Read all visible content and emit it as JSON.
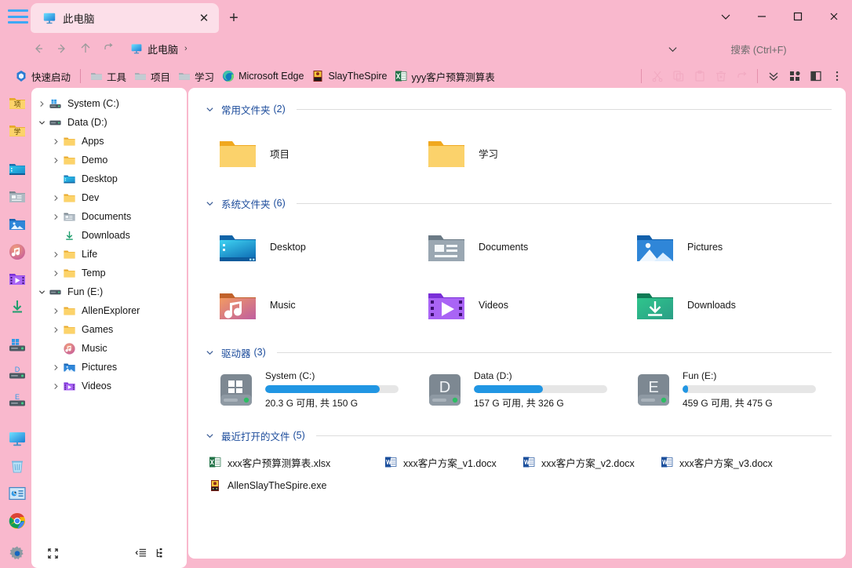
{
  "window": {
    "tab": {
      "title": "此电脑",
      "icon": "this-pc-icon",
      "close": "✕"
    },
    "new_tab": "+",
    "controls": {
      "chevron": "chevron-down-icon",
      "minimize": "minimize-icon",
      "maximize": "maximize-icon",
      "close": "close-icon"
    }
  },
  "addressbar": {
    "back": "back-arrow-icon",
    "forward": "forward-arrow-icon",
    "up": "up-arrow-icon",
    "refresh": "undo-icon",
    "breadcrumb": {
      "label": "此电脑",
      "arrow": "›"
    },
    "search_placeholder": "搜索 (Ctrl+F)",
    "search_chevron": "chevron-down-icon"
  },
  "quicklaunch": {
    "title": "快速启动",
    "items": [
      {
        "label": "工具",
        "icon": "folder-icon"
      },
      {
        "label": "项目",
        "icon": "folder-icon"
      },
      {
        "label": "学习",
        "icon": "folder-icon"
      },
      {
        "label": "Microsoft Edge",
        "icon": "edge-icon"
      },
      {
        "label": "SlayTheSpire",
        "icon": "game-exe-icon"
      },
      {
        "label": "yyy客户预算测算表",
        "icon": "excel-icon"
      }
    ],
    "toolbar": [
      {
        "name": "cut-icon"
      },
      {
        "name": "copy-icon"
      },
      {
        "name": "paste-icon"
      },
      {
        "name": "delete-icon"
      },
      {
        "name": "undo-icon"
      },
      {
        "name": "chevron-double-down-icon"
      },
      {
        "name": "layout-grid-icon"
      },
      {
        "name": "split-pane-icon"
      },
      {
        "name": "more-options-icon"
      }
    ]
  },
  "rail": {
    "items": [
      {
        "name": "rail-folder-xiang",
        "label": "项"
      },
      {
        "name": "rail-folder-xue",
        "label": "学"
      },
      {
        "name": "rail-desktop"
      },
      {
        "name": "rail-documents"
      },
      {
        "name": "rail-pictures"
      },
      {
        "name": "rail-music"
      },
      {
        "name": "rail-videos"
      },
      {
        "name": "rail-downloads"
      },
      {
        "name": "rail-drive-c"
      },
      {
        "name": "rail-drive-d"
      },
      {
        "name": "rail-drive-e"
      },
      {
        "name": "rail-this-pc"
      },
      {
        "name": "rail-recycle-bin"
      },
      {
        "name": "rail-control-panel"
      },
      {
        "name": "rail-chrome"
      },
      {
        "name": "rail-settings"
      }
    ]
  },
  "tree": {
    "nodes": [
      {
        "label": "System (C:)",
        "icon": "drive-windows-icon",
        "indent": 0,
        "chevron": "collapsed"
      },
      {
        "label": "Data (D:)",
        "icon": "drive-icon",
        "indent": 0,
        "chevron": "expanded"
      },
      {
        "label": "Apps",
        "icon": "folder-icon",
        "indent": 1,
        "chevron": "collapsed"
      },
      {
        "label": "Demo",
        "icon": "folder-icon",
        "indent": 1,
        "chevron": "collapsed"
      },
      {
        "label": "Desktop",
        "icon": "desktop-folder-icon",
        "indent": 1,
        "chevron": "none"
      },
      {
        "label": "Dev",
        "icon": "folder-icon",
        "indent": 1,
        "chevron": "collapsed"
      },
      {
        "label": "Documents",
        "icon": "documents-folder-icon",
        "indent": 1,
        "chevron": "collapsed"
      },
      {
        "label": "Downloads",
        "icon": "downloads-arrow-icon",
        "indent": 1,
        "chevron": "none"
      },
      {
        "label": "Life",
        "icon": "folder-icon",
        "indent": 1,
        "chevron": "collapsed"
      },
      {
        "label": "Temp",
        "icon": "folder-icon",
        "indent": 1,
        "chevron": "collapsed"
      },
      {
        "label": "Fun (E:)",
        "icon": "drive-icon",
        "indent": 0,
        "chevron": "expanded"
      },
      {
        "label": "AllenExplorer",
        "icon": "folder-icon",
        "indent": 1,
        "chevron": "collapsed"
      },
      {
        "label": "Games",
        "icon": "folder-icon",
        "indent": 1,
        "chevron": "collapsed"
      },
      {
        "label": "Music",
        "icon": "music-circle-icon",
        "indent": 1,
        "chevron": "none"
      },
      {
        "label": "Pictures",
        "icon": "pictures-folder-icon",
        "indent": 1,
        "chevron": "collapsed"
      },
      {
        "label": "Videos",
        "icon": "videos-folder-icon",
        "indent": 1,
        "chevron": "collapsed"
      }
    ]
  },
  "statusbar": {
    "buttons": [
      {
        "name": "collapse-all-icon"
      },
      {
        "name": "indent-list-icon"
      },
      {
        "name": "tree-view-icon"
      }
    ]
  },
  "main": {
    "groups": [
      {
        "id": "frequent",
        "title": "常用文件夹",
        "count": "(2)",
        "items": [
          {
            "label": "项目",
            "icon": "folder-icon"
          },
          {
            "label": "学习",
            "icon": "folder-icon"
          }
        ]
      },
      {
        "id": "system",
        "title": "系统文件夹",
        "count": "(6)",
        "items": [
          {
            "label": "Desktop",
            "icon": "desktop-folder-icon"
          },
          {
            "label": "Documents",
            "icon": "documents-folder-icon"
          },
          {
            "label": "Pictures",
            "icon": "pictures-folder-icon"
          },
          {
            "label": "Music",
            "icon": "music-folder-icon"
          },
          {
            "label": "Videos",
            "icon": "videos-folder-icon"
          },
          {
            "label": "Downloads",
            "icon": "downloads-folder-icon"
          }
        ]
      },
      {
        "id": "drives",
        "title": "驱动器",
        "count": "(3)",
        "drives": [
          {
            "name": "System (C:)",
            "letter": "",
            "icon": "drive-windows-icon",
            "free_text": "20.3 G 可用, 共 150 G",
            "used_percent": 86
          },
          {
            "name": "Data (D:)",
            "letter": "D",
            "icon": "drive-letter-icon",
            "free_text": "157 G 可用, 共 326 G",
            "used_percent": 52
          },
          {
            "name": "Fun (E:)",
            "letter": "E",
            "icon": "drive-letter-icon",
            "free_text": "459 G 可用, 共 475 G",
            "used_percent": 4
          }
        ]
      },
      {
        "id": "recent",
        "title": "最近打开的文件",
        "count": "(5)",
        "files": [
          {
            "label": "xxx客户预算测算表.xlsx",
            "icon": "excel-icon"
          },
          {
            "label": "xxx客户方案_v1.docx",
            "icon": "word-icon"
          },
          {
            "label": "xxx客户方案_v2.docx",
            "icon": "word-icon"
          },
          {
            "label": "xxx客户方案_v3.docx",
            "icon": "word-icon"
          },
          {
            "label": "AllenSlayTheSpire.exe",
            "icon": "game-exe-icon"
          }
        ]
      }
    ]
  },
  "colors": {
    "chrome_pink": "#f9b8cd",
    "tab_active": "#fcdfe9",
    "group_title": "#1b4b9b",
    "drive_bar": "#2196e3",
    "panel": "#ffffff"
  }
}
